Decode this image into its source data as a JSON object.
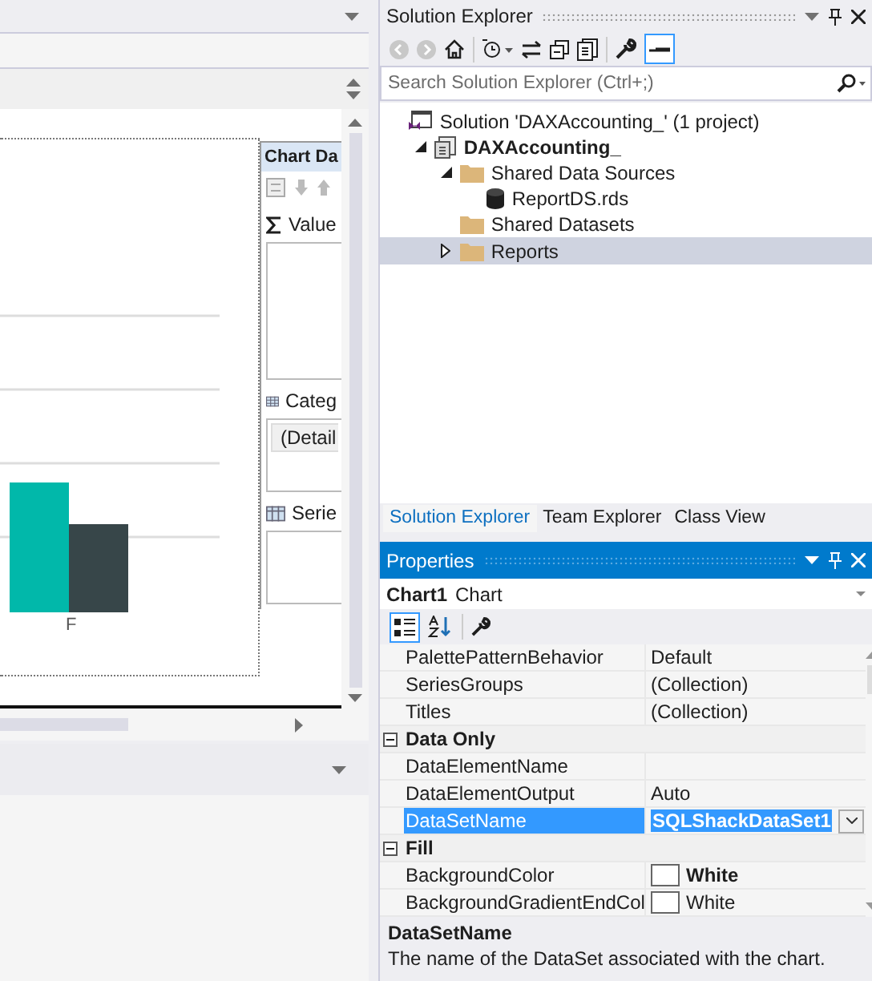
{
  "designer": {
    "chart_x_label": "F",
    "chart_data_panel": {
      "title": "Chart Da",
      "sections": [
        {
          "kind": "values",
          "label": "Value"
        },
        {
          "kind": "categories",
          "label": "Categ",
          "items": [
            "(Detail"
          ]
        },
        {
          "kind": "series",
          "label": "Serie"
        }
      ]
    }
  },
  "solution_explorer": {
    "title": "Solution Explorer",
    "search": {
      "placeholder": "Search Solution Explorer (Ctrl+;)"
    },
    "tree": [
      {
        "kind": "solution",
        "label": "Solution 'DAXAccounting_' (1 project)",
        "selected": false,
        "children": [
          {
            "kind": "project",
            "label": "DAXAccounting_",
            "expanded": true,
            "selected": false,
            "children": [
              {
                "kind": "folder",
                "label": "Shared Data Sources",
                "expanded": true,
                "selected": false,
                "children": [
                  {
                    "kind": "database",
                    "label": "ReportDS.rds",
                    "selected": false
                  }
                ]
              },
              {
                "kind": "folder",
                "label": "Shared Datasets",
                "selected": false
              },
              {
                "kind": "folder",
                "label": "Reports",
                "expanded": false,
                "selected": true
              }
            ]
          }
        ]
      }
    ],
    "tabs": [
      {
        "label": "Solution Explorer",
        "selected": true
      },
      {
        "label": "Team Explorer",
        "selected": false
      },
      {
        "label": "Class View",
        "selected": false
      }
    ]
  },
  "properties": {
    "title": "Properties",
    "object_name": "Chart1",
    "object_type": "Chart",
    "rows": [
      {
        "kind": "property",
        "name": "PalettePatternBehavior",
        "value": "Default",
        "selected": false,
        "modified": false
      },
      {
        "kind": "property",
        "name": "SeriesGroups",
        "value": "(Collection)",
        "selected": false,
        "modified": false
      },
      {
        "kind": "property",
        "name": "Titles",
        "value": "(Collection)",
        "selected": false,
        "modified": false
      },
      {
        "kind": "category",
        "name": "Data Only",
        "expanded": true
      },
      {
        "kind": "property",
        "name": "DataElementName",
        "selected": false
      },
      {
        "kind": "property",
        "name": "DataElementOutput",
        "value": "Auto",
        "selected": false,
        "modified": false
      },
      {
        "kind": "property",
        "name": "DataSetName",
        "value": "SQLShackDataSet1",
        "selected": true,
        "modified": true
      },
      {
        "kind": "category",
        "name": "Fill",
        "expanded": true
      },
      {
        "kind": "color",
        "name": "BackgroundColor",
        "value": "White",
        "color": "#ffffff",
        "selected": false,
        "modified": true
      },
      {
        "kind": "color",
        "name": "BackgroundGradientEndCol",
        "value": "White",
        "color": "#ffffff",
        "selected": false,
        "modified": false
      }
    ],
    "description": {
      "title": "DataSetName",
      "text": "The name of the DataSet associated with the chart."
    }
  }
}
